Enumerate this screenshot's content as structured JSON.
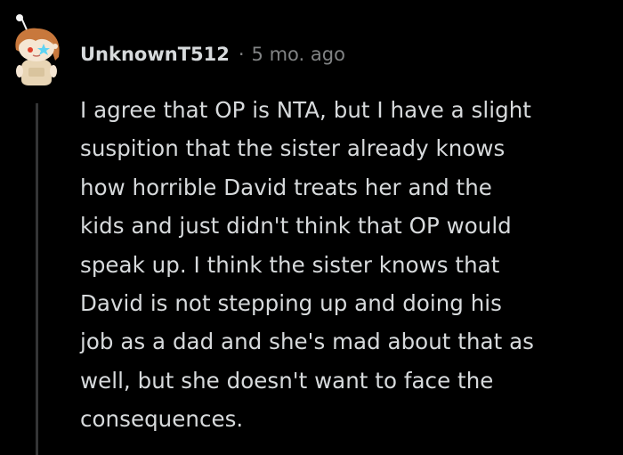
{
  "comment": {
    "username": "UnknownT512",
    "separator": "·",
    "timestamp": "5 mo. ago",
    "body_lines": [
      "I agree that OP is NTA, but I have a slight",
      "suspition that the sister already knows",
      "how horrible David treats her and the",
      "kids and just didn't think that OP would",
      "speak up. I think the sister knows that",
      "David is not stepping up and doing his",
      "job as a dad and she's mad about that as",
      "well, but she doesn't want to face the",
      "consequences."
    ]
  },
  "avatar": {
    "icon": "snoo-avatar-icon",
    "colors": {
      "hair": "#c8783c",
      "face": "#f5e6d3",
      "outfit": "#e8d5b5",
      "star": "#5fd3f3",
      "antenna": "#f5f5f5"
    }
  },
  "colors": {
    "background": "#000000",
    "username": "#d7dadc",
    "meta": "#818384",
    "body": "#d7dadc",
    "thread_line": "#343536"
  }
}
